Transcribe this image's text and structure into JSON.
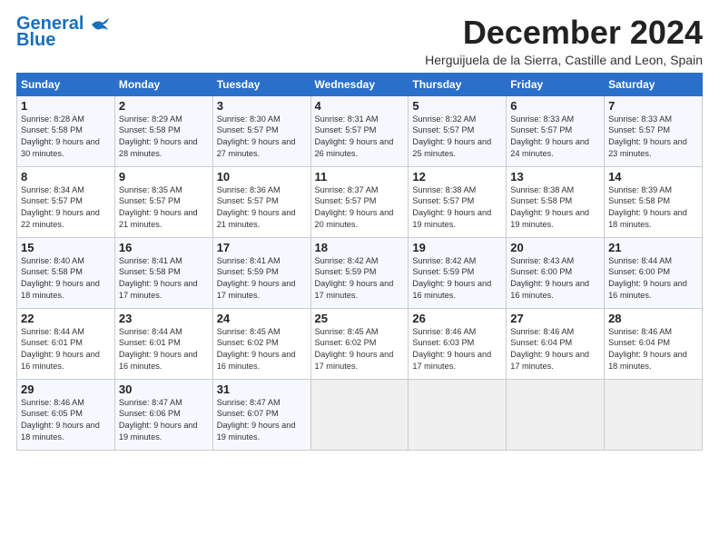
{
  "header": {
    "logo_line1": "General",
    "logo_line2": "Blue",
    "month_title": "December 2024",
    "subtitle": "Herguijuela de la Sierra, Castille and Leon, Spain"
  },
  "days_of_week": [
    "Sunday",
    "Monday",
    "Tuesday",
    "Wednesday",
    "Thursday",
    "Friday",
    "Saturday"
  ],
  "weeks": [
    [
      {
        "day": "1",
        "sunrise": "Sunrise: 8:28 AM",
        "sunset": "Sunset: 5:58 PM",
        "daylight": "Daylight: 9 hours and 30 minutes."
      },
      {
        "day": "2",
        "sunrise": "Sunrise: 8:29 AM",
        "sunset": "Sunset: 5:58 PM",
        "daylight": "Daylight: 9 hours and 28 minutes."
      },
      {
        "day": "3",
        "sunrise": "Sunrise: 8:30 AM",
        "sunset": "Sunset: 5:57 PM",
        "daylight": "Daylight: 9 hours and 27 minutes."
      },
      {
        "day": "4",
        "sunrise": "Sunrise: 8:31 AM",
        "sunset": "Sunset: 5:57 PM",
        "daylight": "Daylight: 9 hours and 26 minutes."
      },
      {
        "day": "5",
        "sunrise": "Sunrise: 8:32 AM",
        "sunset": "Sunset: 5:57 PM",
        "daylight": "Daylight: 9 hours and 25 minutes."
      },
      {
        "day": "6",
        "sunrise": "Sunrise: 8:33 AM",
        "sunset": "Sunset: 5:57 PM",
        "daylight": "Daylight: 9 hours and 24 minutes."
      },
      {
        "day": "7",
        "sunrise": "Sunrise: 8:33 AM",
        "sunset": "Sunset: 5:57 PM",
        "daylight": "Daylight: 9 hours and 23 minutes."
      }
    ],
    [
      {
        "day": "8",
        "sunrise": "Sunrise: 8:34 AM",
        "sunset": "Sunset: 5:57 PM",
        "daylight": "Daylight: 9 hours and 22 minutes."
      },
      {
        "day": "9",
        "sunrise": "Sunrise: 8:35 AM",
        "sunset": "Sunset: 5:57 PM",
        "daylight": "Daylight: 9 hours and 21 minutes."
      },
      {
        "day": "10",
        "sunrise": "Sunrise: 8:36 AM",
        "sunset": "Sunset: 5:57 PM",
        "daylight": "Daylight: 9 hours and 21 minutes."
      },
      {
        "day": "11",
        "sunrise": "Sunrise: 8:37 AM",
        "sunset": "Sunset: 5:57 PM",
        "daylight": "Daylight: 9 hours and 20 minutes."
      },
      {
        "day": "12",
        "sunrise": "Sunrise: 8:38 AM",
        "sunset": "Sunset: 5:57 PM",
        "daylight": "Daylight: 9 hours and 19 minutes."
      },
      {
        "day": "13",
        "sunrise": "Sunrise: 8:38 AM",
        "sunset": "Sunset: 5:58 PM",
        "daylight": "Daylight: 9 hours and 19 minutes."
      },
      {
        "day": "14",
        "sunrise": "Sunrise: 8:39 AM",
        "sunset": "Sunset: 5:58 PM",
        "daylight": "Daylight: 9 hours and 18 minutes."
      }
    ],
    [
      {
        "day": "15",
        "sunrise": "Sunrise: 8:40 AM",
        "sunset": "Sunset: 5:58 PM",
        "daylight": "Daylight: 9 hours and 18 minutes."
      },
      {
        "day": "16",
        "sunrise": "Sunrise: 8:41 AM",
        "sunset": "Sunset: 5:58 PM",
        "daylight": "Daylight: 9 hours and 17 minutes."
      },
      {
        "day": "17",
        "sunrise": "Sunrise: 8:41 AM",
        "sunset": "Sunset: 5:59 PM",
        "daylight": "Daylight: 9 hours and 17 minutes."
      },
      {
        "day": "18",
        "sunrise": "Sunrise: 8:42 AM",
        "sunset": "Sunset: 5:59 PM",
        "daylight": "Daylight: 9 hours and 17 minutes."
      },
      {
        "day": "19",
        "sunrise": "Sunrise: 8:42 AM",
        "sunset": "Sunset: 5:59 PM",
        "daylight": "Daylight: 9 hours and 16 minutes."
      },
      {
        "day": "20",
        "sunrise": "Sunrise: 8:43 AM",
        "sunset": "Sunset: 6:00 PM",
        "daylight": "Daylight: 9 hours and 16 minutes."
      },
      {
        "day": "21",
        "sunrise": "Sunrise: 8:44 AM",
        "sunset": "Sunset: 6:00 PM",
        "daylight": "Daylight: 9 hours and 16 minutes."
      }
    ],
    [
      {
        "day": "22",
        "sunrise": "Sunrise: 8:44 AM",
        "sunset": "Sunset: 6:01 PM",
        "daylight": "Daylight: 9 hours and 16 minutes."
      },
      {
        "day": "23",
        "sunrise": "Sunrise: 8:44 AM",
        "sunset": "Sunset: 6:01 PM",
        "daylight": "Daylight: 9 hours and 16 minutes."
      },
      {
        "day": "24",
        "sunrise": "Sunrise: 8:45 AM",
        "sunset": "Sunset: 6:02 PM",
        "daylight": "Daylight: 9 hours and 16 minutes."
      },
      {
        "day": "25",
        "sunrise": "Sunrise: 8:45 AM",
        "sunset": "Sunset: 6:02 PM",
        "daylight": "Daylight: 9 hours and 17 minutes."
      },
      {
        "day": "26",
        "sunrise": "Sunrise: 8:46 AM",
        "sunset": "Sunset: 6:03 PM",
        "daylight": "Daylight: 9 hours and 17 minutes."
      },
      {
        "day": "27",
        "sunrise": "Sunrise: 8:46 AM",
        "sunset": "Sunset: 6:04 PM",
        "daylight": "Daylight: 9 hours and 17 minutes."
      },
      {
        "day": "28",
        "sunrise": "Sunrise: 8:46 AM",
        "sunset": "Sunset: 6:04 PM",
        "daylight": "Daylight: 9 hours and 18 minutes."
      }
    ],
    [
      {
        "day": "29",
        "sunrise": "Sunrise: 8:46 AM",
        "sunset": "Sunset: 6:05 PM",
        "daylight": "Daylight: 9 hours and 18 minutes."
      },
      {
        "day": "30",
        "sunrise": "Sunrise: 8:47 AM",
        "sunset": "Sunset: 6:06 PM",
        "daylight": "Daylight: 9 hours and 19 minutes."
      },
      {
        "day": "31",
        "sunrise": "Sunrise: 8:47 AM",
        "sunset": "Sunset: 6:07 PM",
        "daylight": "Daylight: 9 hours and 19 minutes."
      },
      null,
      null,
      null,
      null
    ]
  ]
}
